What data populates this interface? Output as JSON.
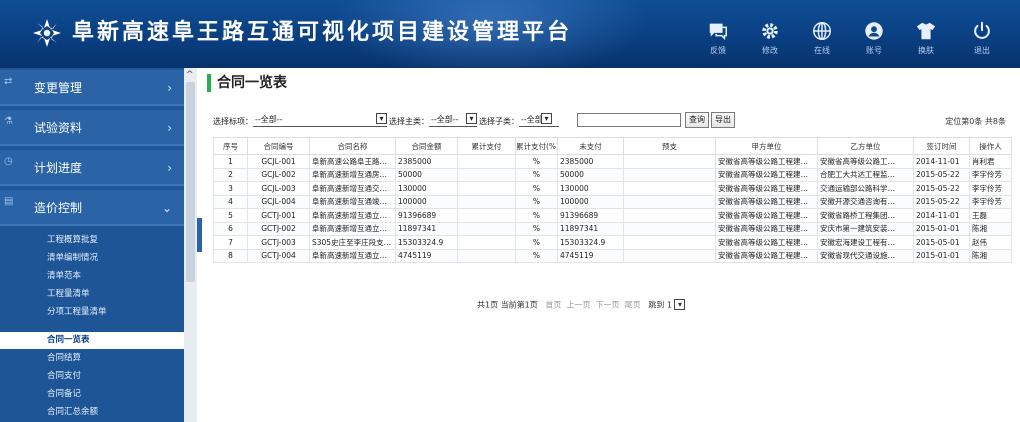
{
  "app": {
    "title": "阜新高速阜王路互通可视化项目建设管理平台"
  },
  "header_actions": [
    {
      "label": "反馈",
      "icon": "feedback-icon"
    },
    {
      "label": "修改",
      "icon": "gear-icon"
    },
    {
      "label": "在线",
      "icon": "globe-icon"
    },
    {
      "label": "账号",
      "icon": "user-icon"
    },
    {
      "label": "换肤",
      "icon": "shirt-icon"
    },
    {
      "label": "退出",
      "icon": "power-icon"
    }
  ],
  "sidebar": {
    "menus": [
      {
        "label": "变更管理",
        "chevron": "›"
      },
      {
        "label": "试验资料",
        "chevron": "›"
      },
      {
        "label": "计划进度",
        "chevron": "›"
      },
      {
        "label": "造价控制",
        "chevron": "⌄"
      }
    ],
    "submenu": [
      "工程概算批复",
      "清单编制情况",
      "清单范本",
      "工程量清单",
      "分项工程量清单",
      "合同一览表",
      "合同结算",
      "合同支付",
      "合同备记",
      "合同汇总余额"
    ],
    "current": "合同一览表"
  },
  "page": {
    "title": "合同一览表"
  },
  "filters": {
    "project_label": "选择标项：",
    "project_value": "--全部--",
    "party_a_label": "选择主类：",
    "party_a_value": "--全部--",
    "party_b_label": "选择子类：",
    "party_b_value": "--全部--",
    "search_value": "",
    "query_button": "查询",
    "export_button": "导出",
    "summary": "定位第0条 共8条"
  },
  "table": {
    "headers": [
      "序号",
      "合同编号",
      "合同名称",
      "合同金额",
      "累计支付",
      "累计支付(%)",
      "未支付",
      "预支",
      "甲方单位",
      "乙方单位",
      "签订时间",
      "操作人"
    ],
    "rows": [
      [
        "1",
        "GCJL-001",
        "阜新高速公路阜王路互通…",
        "2385000",
        "",
        "%",
        "2385000",
        "",
        "安徽省高等级公路工程建…",
        "安徽省高等级公路工…",
        "2014-11-01",
        "肖利君"
      ],
      [
        "2",
        "GCJL-002",
        "阜新高速新增互通房建…",
        "50000",
        "",
        "%",
        "50000",
        "",
        "安徽省高等级公路工程建…",
        "合肥工大共达工程监…",
        "2015-05-22",
        "李宇伶芳"
      ],
      [
        "3",
        "GCJL-003",
        "阜新高速新增互通交工…",
        "130000",
        "",
        "%",
        "130000",
        "",
        "安徽省高等级公路工程建…",
        "交通运输部公路科学…",
        "2015-05-22",
        "李宇伶芳"
      ],
      [
        "4",
        "GCJL-004",
        "阜新高速新增互通竣工…",
        "100000",
        "",
        "%",
        "100000",
        "",
        "安徽省高等级公路工程建…",
        "安徽开源交通咨询有…",
        "2015-05-22",
        "李宇伶芳"
      ],
      [
        "5",
        "GCTJ-001",
        "阜新高速新增互通立交…",
        "91396689",
        "",
        "%",
        "91396689",
        "",
        "安徽省高等级公路工程建…",
        "安徽省路桥工程集团…",
        "2014-11-01",
        "王磊"
      ],
      [
        "6",
        "GCTJ-002",
        "阜新高速新增互通立交…",
        "11897341",
        "",
        "%",
        "11897341",
        "",
        "安徽省高等级公路工程建…",
        "安庆市第一建筑安装…",
        "2015-01-01",
        "陈湘"
      ],
      [
        "7",
        "GCTJ-003",
        "S305史庄至李庄段支线…",
        "15303324.9",
        "",
        "%",
        "15303324.9",
        "",
        "安徽省高等级公路工程建…",
        "安徽宏海建设工程有…",
        "2015-05-01",
        "赵伟"
      ],
      [
        "8",
        "GCTJ-004",
        "阜新高速新增互通立交…",
        "4745119",
        "",
        "%",
        "4745119",
        "",
        "安徽省高等级公路工程建…",
        "安徽省现代交通设施…",
        "2015-01-01",
        "陈湘"
      ]
    ]
  },
  "pager": {
    "info": "共1页 当前第1页",
    "first": "首页",
    "prev": "上一页",
    "next": "下一页",
    "last": "尾页",
    "jump_label": "跳到",
    "jump_value": "1"
  },
  "colors": {
    "header_bg": "#0a3f82",
    "sidebar_bg": "#1d5597",
    "menu_bg": "#2a64a6",
    "title_accent": "#24b04d"
  }
}
